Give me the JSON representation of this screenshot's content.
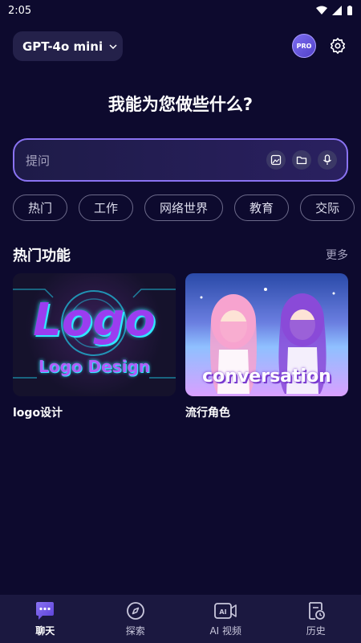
{
  "status": {
    "time": "2:05"
  },
  "header": {
    "model": "GPT-4o mini",
    "pro_badge": "PRO"
  },
  "hero": {
    "title": "我能为您做些什么?"
  },
  "search": {
    "placeholder": "提问"
  },
  "chips": [
    "热门",
    "工作",
    "网络世界",
    "教育",
    "交际"
  ],
  "section": {
    "title": "热门功能",
    "more": "更多"
  },
  "cards": [
    {
      "label": "logo设计",
      "art_main": "Logo",
      "art_sub": "Logo Design"
    },
    {
      "label": "流行角色",
      "art_text": "conversation"
    }
  ],
  "nav": [
    {
      "label": "聊天",
      "icon": "chat-icon",
      "active": true
    },
    {
      "label": "探索",
      "icon": "compass-icon",
      "active": false
    },
    {
      "label": "AI 视频",
      "icon": "ai-video-icon",
      "active": false
    },
    {
      "label": "历史",
      "icon": "history-icon",
      "active": false
    }
  ],
  "colors": {
    "background": "#0d0a2e",
    "accent": "#8a73f2",
    "nav": "#1b1840"
  }
}
